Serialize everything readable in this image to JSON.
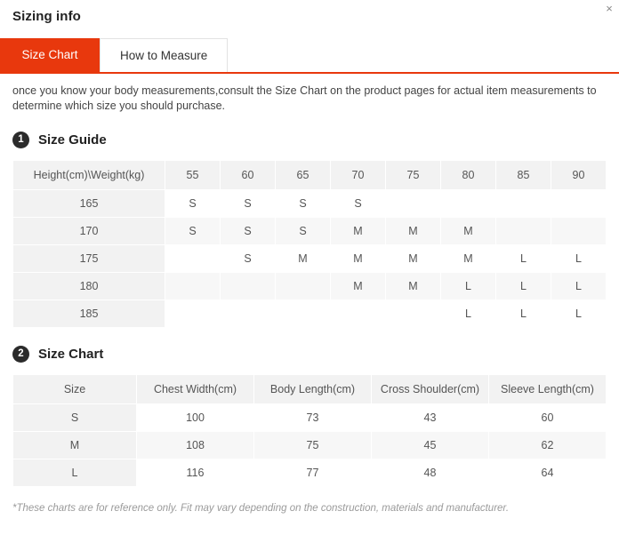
{
  "header": {
    "title": "Sizing info",
    "close_label": "×"
  },
  "tabs": [
    {
      "label": "Size Chart",
      "active": true
    },
    {
      "label": "How to Measure",
      "active": false
    }
  ],
  "intro": "once you know your body measurements,consult the Size Chart on the product pages for actual item measurements to determine which size you should purchase.",
  "sections": [
    {
      "number": "1",
      "title": "Size Guide"
    },
    {
      "number": "2",
      "title": "Size Chart"
    }
  ],
  "size_guide": {
    "corner_header": "Height(cm)\\Weight(kg)",
    "weights": [
      "55",
      "60",
      "65",
      "70",
      "75",
      "80",
      "85",
      "90"
    ],
    "rows": [
      {
        "height": "165",
        "sizes": [
          "S",
          "S",
          "S",
          "S",
          "",
          "",
          "",
          ""
        ]
      },
      {
        "height": "170",
        "sizes": [
          "S",
          "S",
          "S",
          "M",
          "M",
          "M",
          "",
          ""
        ]
      },
      {
        "height": "175",
        "sizes": [
          "",
          "S",
          "M",
          "M",
          "M",
          "M",
          "L",
          "L"
        ]
      },
      {
        "height": "180",
        "sizes": [
          "",
          "",
          "",
          "M",
          "M",
          "L",
          "L",
          "L"
        ]
      },
      {
        "height": "185",
        "sizes": [
          "",
          "",
          "",
          "",
          "",
          "L",
          "L",
          "L"
        ]
      }
    ]
  },
  "size_chart": {
    "columns": [
      "Size",
      "Chest Width(cm)",
      "Body Length(cm)",
      "Cross Shoulder(cm)",
      "Sleeve Length(cm)"
    ],
    "rows": [
      {
        "size": "S",
        "values": [
          "100",
          "73",
          "43",
          "60"
        ]
      },
      {
        "size": "M",
        "values": [
          "108",
          "75",
          "45",
          "62"
        ]
      },
      {
        "size": "L",
        "values": [
          "116",
          "77",
          "48",
          "64"
        ]
      }
    ]
  },
  "footnote": "*These charts are for reference only. Fit may vary depending on the construction, materials and manufacturer.",
  "colors": {
    "accent": "#e8380d",
    "header_bg": "#f2f2f2",
    "stripe": "#f7f7f7",
    "badge": "#2b2b2b"
  }
}
